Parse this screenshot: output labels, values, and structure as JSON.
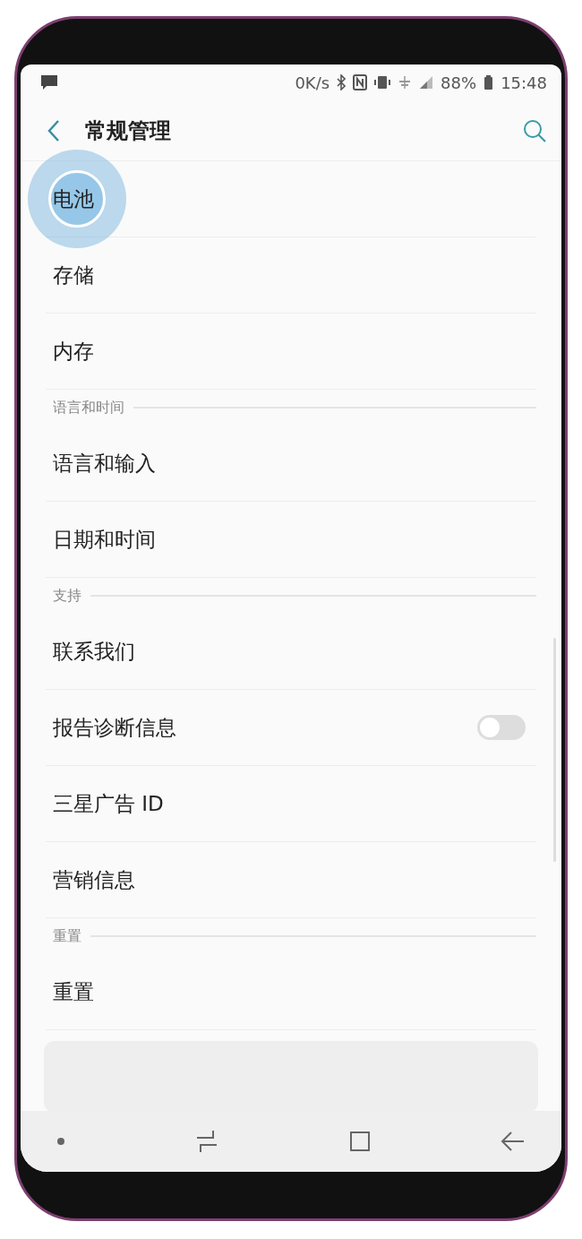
{
  "status_bar": {
    "speed": "0K/s",
    "battery": "88%",
    "time": "15:48"
  },
  "header": {
    "title": "常规管理"
  },
  "items": [
    {
      "kind": "item",
      "label": "电池",
      "tapped": true
    },
    {
      "kind": "item",
      "label": "存储",
      "tapped": false
    },
    {
      "kind": "item",
      "label": "内存",
      "tapped": false
    },
    {
      "kind": "header",
      "label": "语言和时间"
    },
    {
      "kind": "item",
      "label": "语言和输入",
      "tapped": false
    },
    {
      "kind": "item",
      "label": "日期和时间",
      "tapped": false
    },
    {
      "kind": "header",
      "label": "支持"
    },
    {
      "kind": "item",
      "label": "联系我们",
      "tapped": false
    },
    {
      "kind": "toggle",
      "label": "报告诊断信息",
      "on": false
    },
    {
      "kind": "item",
      "label": "三星广告 ID",
      "tapped": false
    },
    {
      "kind": "item",
      "label": "营销信息",
      "tapped": false
    },
    {
      "kind": "header",
      "label": "重置"
    },
    {
      "kind": "item",
      "label": "重置",
      "tapped": false
    },
    {
      "kind": "card"
    }
  ]
}
